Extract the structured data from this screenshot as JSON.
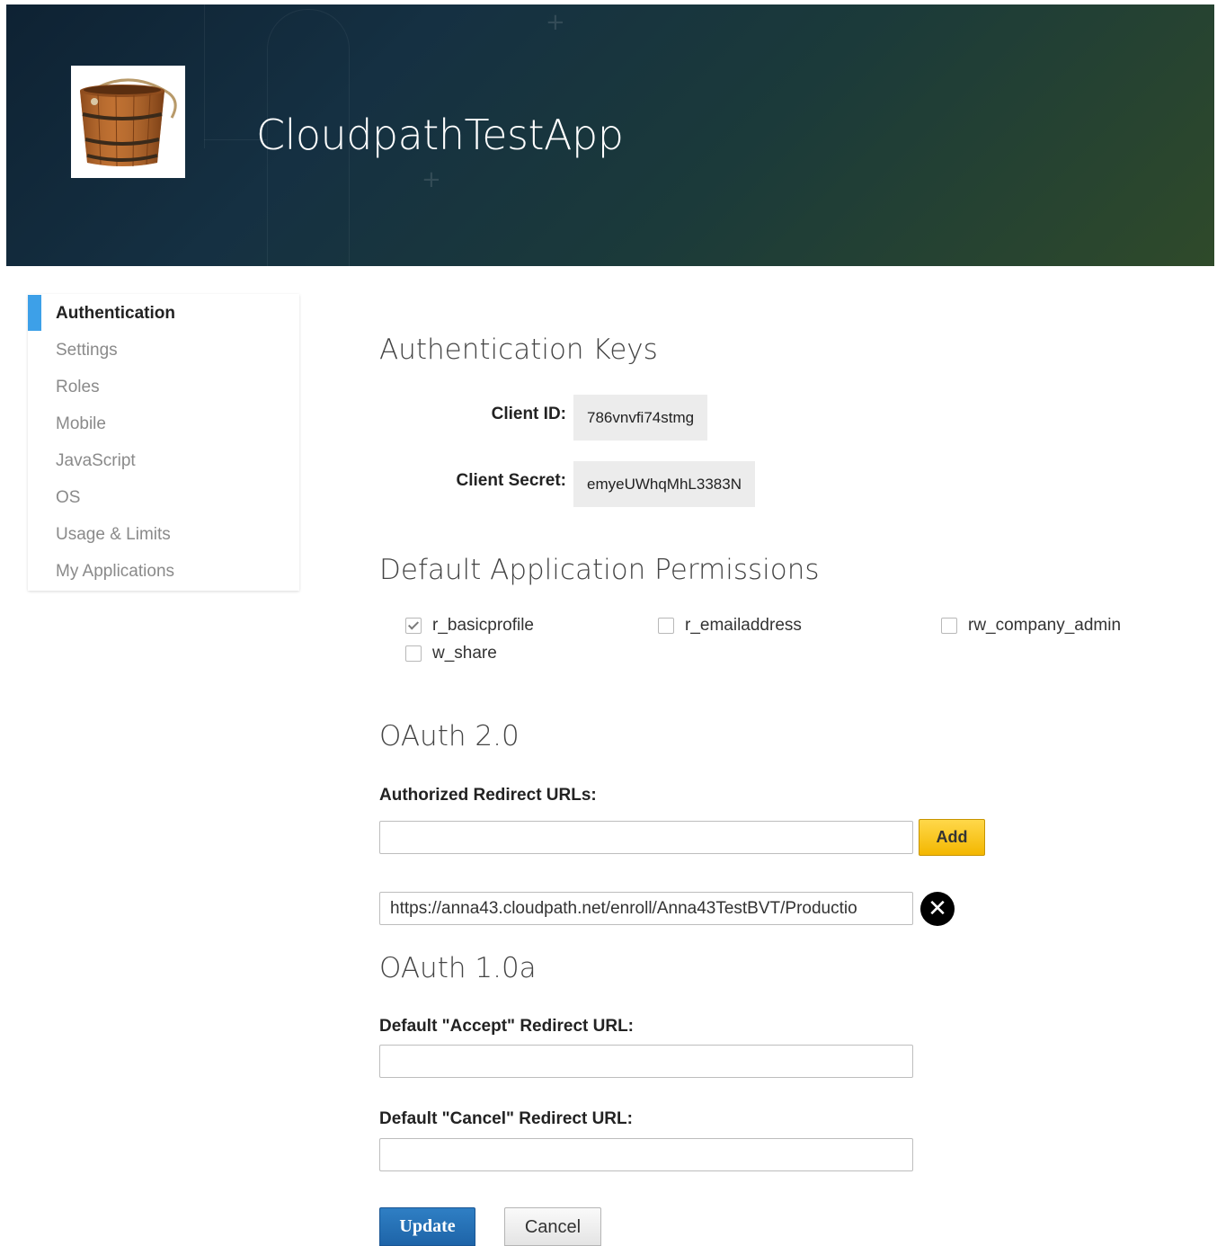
{
  "header": {
    "app_title": "CloudpathTestApp",
    "logo": "wooden-bucket-image"
  },
  "sidebar": {
    "items": [
      {
        "label": "Authentication",
        "active": true
      },
      {
        "label": "Settings"
      },
      {
        "label": "Roles"
      },
      {
        "label": "Mobile"
      },
      {
        "label": "JavaScript"
      },
      {
        "label": "OS"
      },
      {
        "label": "Usage & Limits"
      },
      {
        "label": "My Applications"
      }
    ],
    "accent_color": "#3da0e8"
  },
  "auth_keys": {
    "heading": "Authentication Keys",
    "client_id_label": "Client ID:",
    "client_id_value": "786vnvfi74stmg",
    "client_secret_label": "Client Secret:",
    "client_secret_value": "emyeUWhqMhL3383N"
  },
  "permissions": {
    "heading": "Default Application Permissions",
    "items": [
      {
        "label": "r_basicprofile",
        "checked": true
      },
      {
        "label": "r_emailaddress",
        "checked": false
      },
      {
        "label": "rw_company_admin",
        "checked": false
      },
      {
        "label": "w_share",
        "checked": false
      }
    ]
  },
  "oauth2": {
    "heading": "OAuth 2.0",
    "redirect_label": "Authorized Redirect URLs:",
    "new_url_value": "",
    "add_label": "Add",
    "urls": [
      "https://anna43.cloudpath.net/enroll/Anna43TestBVT/Productio"
    ]
  },
  "oauth1": {
    "heading": "OAuth 1.0a",
    "accept_label": "Default \"Accept\" Redirect URL:",
    "accept_value": "",
    "cancel_label": "Default \"Cancel\" Redirect URL:",
    "cancel_value": ""
  },
  "actions": {
    "update_label": "Update",
    "cancel_label": "Cancel"
  },
  "colors": {
    "primary_button": "#1e64a8",
    "add_button": "#f3b700"
  }
}
